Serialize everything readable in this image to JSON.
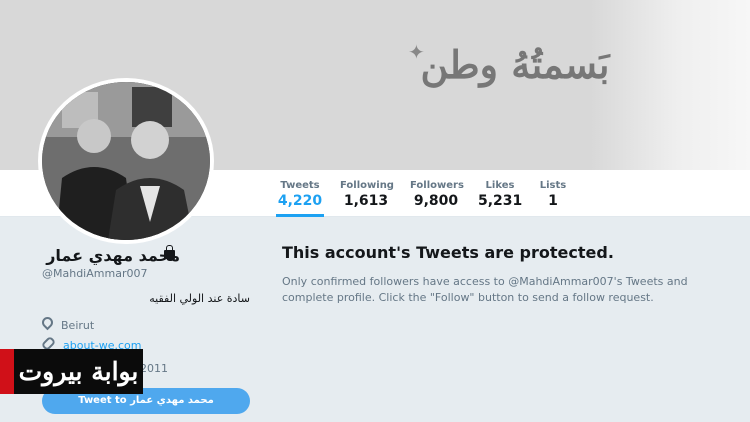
{
  "banner": {
    "text": "بَسمتُهُ وطن"
  },
  "stats": [
    {
      "label": "Tweets",
      "value": "4,220"
    },
    {
      "label": "Following",
      "value": "1,613"
    },
    {
      "label": "Followers",
      "value": "9,800"
    },
    {
      "label": "Likes",
      "value": "5,231"
    },
    {
      "label": "Lists",
      "value": "1"
    }
  ],
  "profile": {
    "name": "محمد مهدي عمار",
    "handle": "@MahdiAmmar007",
    "bio": "سادة عند الولي الفقيه",
    "location": "Beirut",
    "website": "about-we.com",
    "joined": "2011",
    "tweet_to": "Tweet to محمد مهدي عمار"
  },
  "protected": {
    "title": "This account's Tweets are protected.",
    "body": "Only confirmed followers have access to @MahdiAmmar007's Tweets and complete profile. Click the \"Follow\" button to send a follow request."
  },
  "watermark": {
    "text": "بوابة بيروت"
  }
}
